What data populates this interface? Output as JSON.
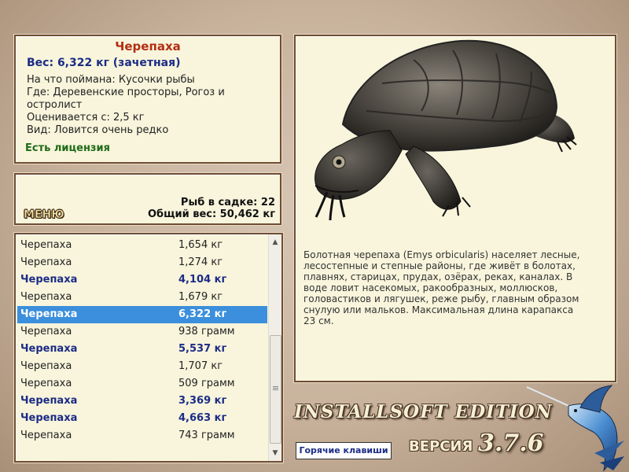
{
  "info": {
    "title": "Черепаха",
    "weight": "Вес: 6,322 кг (зачетная)",
    "bait": "На что поймана: Кусочки рыбы",
    "place": "Где: Деревенские просторы, Рогоз и остролист",
    "rated": "Оценивается с: 2,5 кг",
    "kind": "Вид: Ловится очень редко",
    "license": "Есть лицензия"
  },
  "menu": {
    "label": "МЕНЮ",
    "fish_count": "Рыб в садке: 22",
    "total_weight": "Общий вес: 50,462 кг"
  },
  "catch_list": [
    {
      "name": "Черепаха",
      "weight": "1,654 кг",
      "bold": false,
      "selected": false
    },
    {
      "name": "Черепаха",
      "weight": "1,274 кг",
      "bold": false,
      "selected": false
    },
    {
      "name": "Черепаха",
      "weight": "4,104 кг",
      "bold": true,
      "selected": false
    },
    {
      "name": "Черепаха",
      "weight": "1,679 кг",
      "bold": false,
      "selected": false
    },
    {
      "name": "Черепаха",
      "weight": "6,322 кг",
      "bold": true,
      "selected": true
    },
    {
      "name": "Черепаха",
      "weight": "938 грамм",
      "bold": false,
      "selected": false
    },
    {
      "name": "Черепаха",
      "weight": "5,537 кг",
      "bold": true,
      "selected": false
    },
    {
      "name": "Черепаха",
      "weight": "1,707 кг",
      "bold": false,
      "selected": false
    },
    {
      "name": "Черепаха",
      "weight": "509 грамм",
      "bold": false,
      "selected": false
    },
    {
      "name": "Черепаха",
      "weight": "3,369 кг",
      "bold": true,
      "selected": false
    },
    {
      "name": "Черепаха",
      "weight": "4,663 кг",
      "bold": true,
      "selected": false
    },
    {
      "name": "Черепаха",
      "weight": "743 грамм",
      "bold": false,
      "selected": false
    }
  ],
  "description": "Болотная черепаха (Emys orbicularis) населяет лесные, лесостепные и степные районы, где живёт в болотах, плавнях, старицах, прудах, озёрах, реках, каналах. В воде ловит насекомых, ракообразных, моллюсков, головастиков и лягушек, реже рыбу, главным образом снулую или мальков. Максимальная длина карапакса 23 см.",
  "footer": {
    "hotkeys": "Горячие клавиши",
    "edition": "INSTALLSOFT EDITION",
    "version_label": "ВЕРСИЯ",
    "version": "3.7.6"
  },
  "colors": {
    "panel_bg": "#f8f5dc",
    "title_red": "#b22f12",
    "accent_blue": "#1c2c86",
    "license_green": "#1f6b16",
    "selection": "#3b8fdc"
  },
  "icons": {
    "picture": "turtle-illustration",
    "logo": "marlin-fish-logo",
    "scroll_up": "chevron-up-icon",
    "scroll_down": "chevron-down-icon"
  }
}
